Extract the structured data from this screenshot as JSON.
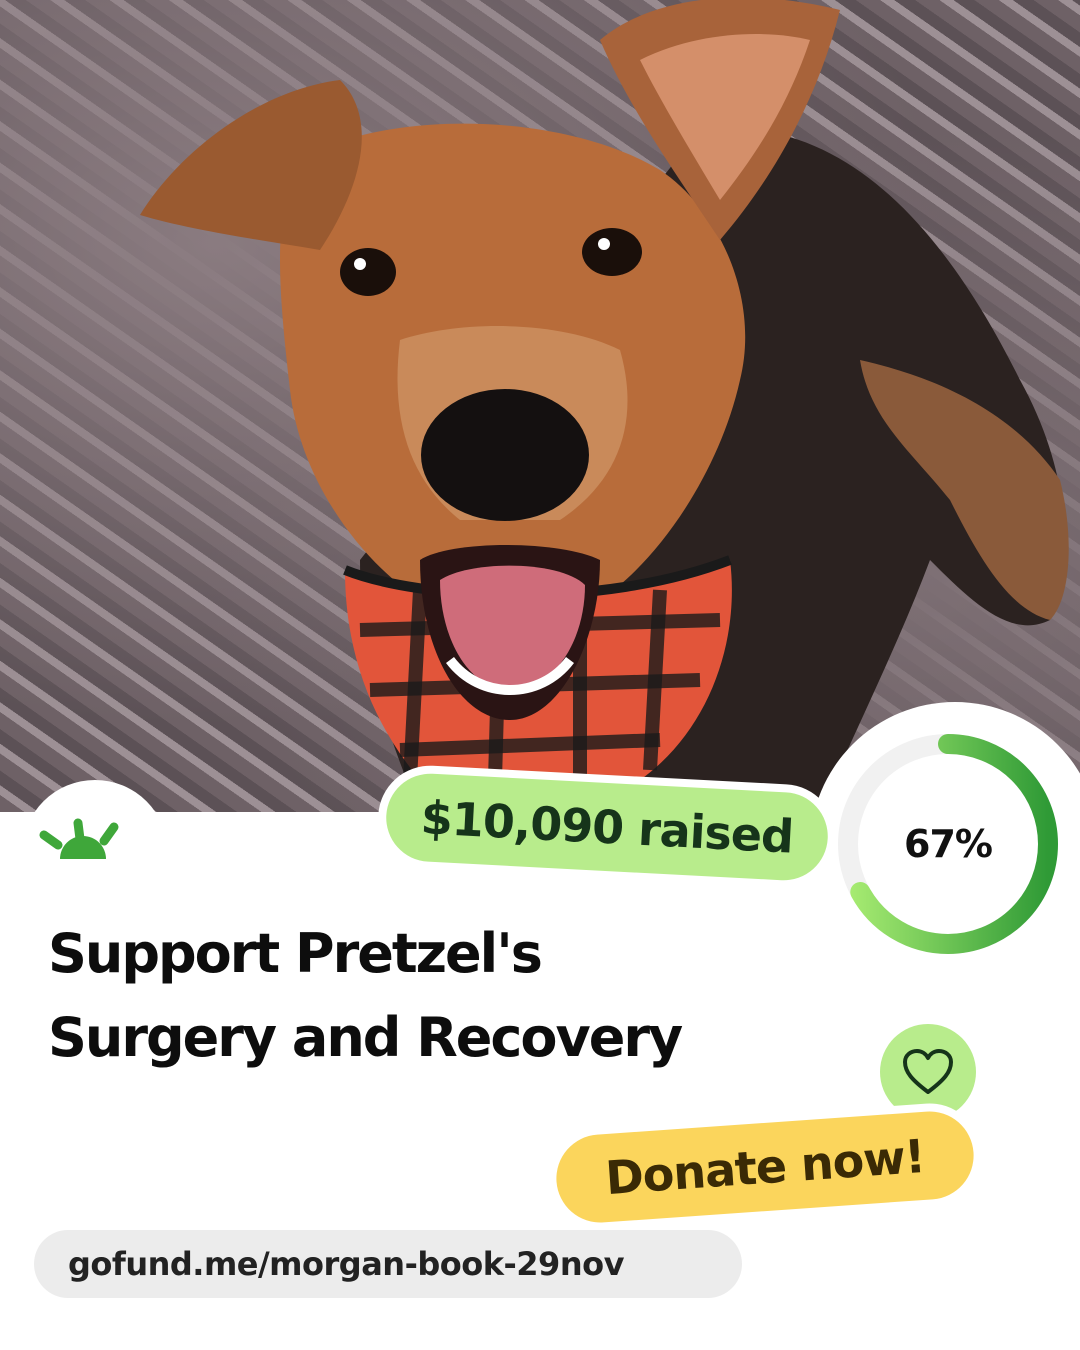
{
  "photo": {
    "subject": "dog-with-plaid-bandana-photo"
  },
  "brand": {
    "logo_icon": "gofundme-sunrise-logo",
    "accent_color": "#b8ec8c",
    "ring_color": "#3fa73a"
  },
  "fundraiser": {
    "raised_label": "$10,090 raised",
    "progress_label": "67%",
    "progress_fraction": 0.67,
    "title_line1": "Support Pretzel's",
    "title_line2": "Surgery and Recovery"
  },
  "cta": {
    "heart_icon": "heart-icon",
    "donate_label": "Donate now!",
    "donate_color": "#fbd55c"
  },
  "link": {
    "url": "gofund.me/morgan-book-29nov"
  }
}
